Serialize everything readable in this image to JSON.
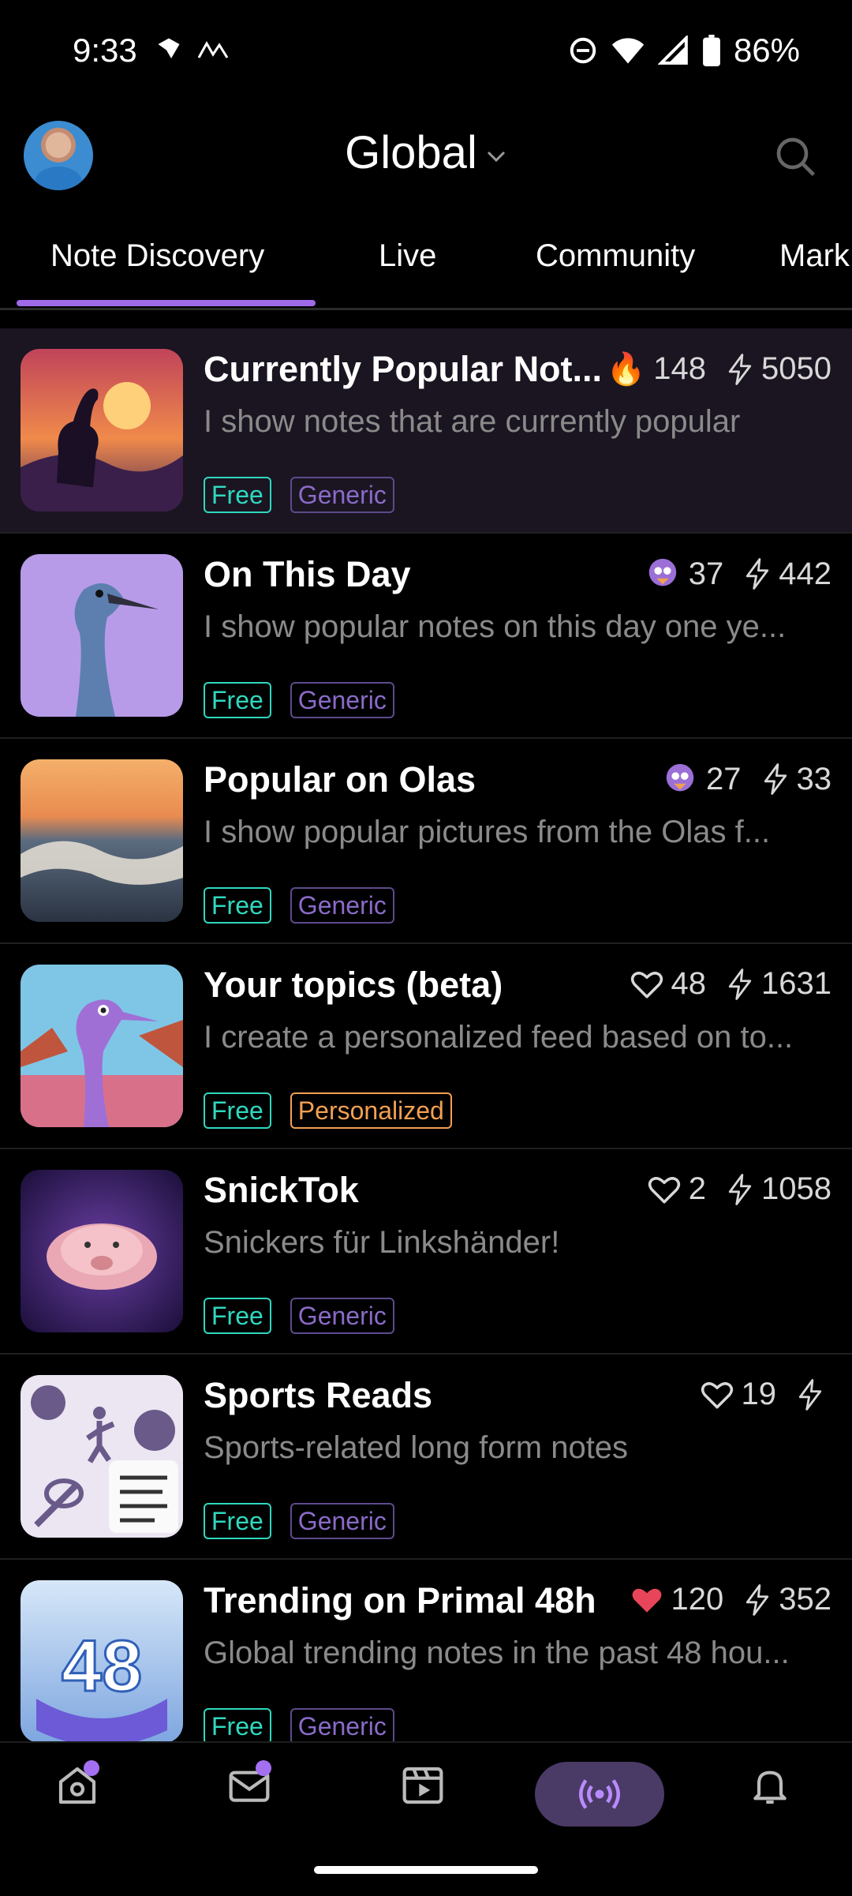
{
  "status_bar": {
    "time": "9:33",
    "battery": "86%"
  },
  "header": {
    "title": "Global"
  },
  "tabs": [
    {
      "label": "Note Discovery"
    },
    {
      "label": "Live"
    },
    {
      "label": "Community"
    },
    {
      "label": "Mark"
    }
  ],
  "feeds": [
    {
      "title": "Currently Popular Not...",
      "description": "I show notes that are currently popular",
      "stat_icon": "fire-icon",
      "likes": "148",
      "zaps": "5050",
      "tags": [
        "Free",
        "Generic"
      ]
    },
    {
      "title": "On This Day",
      "description": "I show popular notes on this day one ye...",
      "stat_icon": "ostrich-emoji-icon",
      "likes": "37",
      "zaps": "442",
      "tags": [
        "Free",
        "Generic"
      ]
    },
    {
      "title": "Popular on Olas",
      "description": "I show popular pictures from the Olas f...",
      "stat_icon": "ostrich-emoji-icon",
      "likes": "27",
      "zaps": "33",
      "tags": [
        "Free",
        "Generic"
      ]
    },
    {
      "title": "Your topics (beta)",
      "description": "I create a personalized feed based on to...",
      "stat_icon": "heart-outline-icon",
      "likes": "48",
      "zaps": "1631",
      "tags": [
        "Free",
        "Personalized"
      ]
    },
    {
      "title": "SnickTok",
      "description": "Snickers für Linkshänder!",
      "stat_icon": "heart-outline-icon",
      "likes": "2",
      "zaps": "1058",
      "tags": [
        "Free",
        "Generic"
      ]
    },
    {
      "title": "Sports Reads",
      "description": "Sports-related long form notes",
      "stat_icon": "heart-outline-icon",
      "likes": "19",
      "zaps": "",
      "tags": [
        "Free",
        "Generic"
      ]
    },
    {
      "title": "Trending on Primal 48h",
      "description": "Global trending notes in the past 48 hou...",
      "stat_icon": "heart-filled-icon",
      "likes": "120",
      "zaps": "352",
      "tags": [
        "Free",
        "Generic"
      ],
      "thumb_text": "48"
    }
  ],
  "colors": {
    "accent": "#9e6ae8",
    "free": "#2fd8bf",
    "generic": "#8a6bc8",
    "personalized": "#f2a052",
    "heart": "#e8455a"
  }
}
